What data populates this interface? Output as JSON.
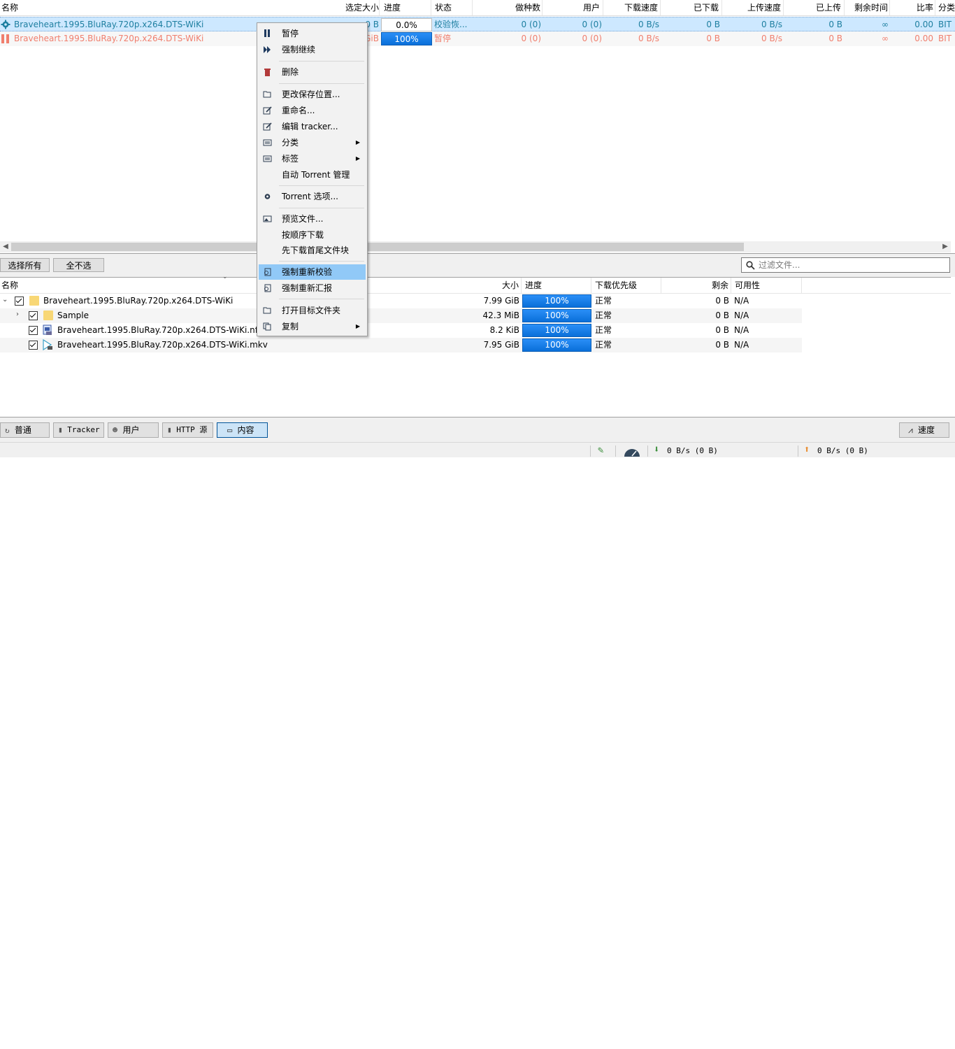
{
  "torrent_table": {
    "columns": [
      "名称",
      "选定大小",
      "进度",
      "状态",
      "做种数",
      "用户",
      "下载速度",
      "已下载",
      "上传速度",
      "已上传",
      "剩余时间",
      "比率",
      "分类"
    ],
    "rows": [
      {
        "name": "Braveheart.1995.BluRay.720p.x264.DTS-WiKi",
        "size": "0 B",
        "progress": "0.0%",
        "progress_value": 0,
        "status": "校验恢...",
        "seeds": "0 (0)",
        "peers": "0 (0)",
        "down_speed": "0 B/s",
        "downloaded": "0 B",
        "up_speed": "0 B/s",
        "uploaded": "0 B",
        "eta": "∞",
        "ratio": "0.00",
        "category": "BIT",
        "color": "#1e7fa0",
        "icon": "gear-icon"
      },
      {
        "name": "Braveheart.1995.BluRay.720p.x264.DTS-WiKi",
        "size": "GiB",
        "progress": "100%",
        "progress_value": 1,
        "status": "暂停",
        "seeds": "0 (0)",
        "peers": "0 (0)",
        "down_speed": "0 B/s",
        "downloaded": "0 B",
        "up_speed": "0 B/s",
        "uploaded": "0 B",
        "eta": "∞",
        "ratio": "0.00",
        "category": "BIT",
        "color": "#f07f6e",
        "icon": "pause-icon"
      }
    ]
  },
  "context_menu": {
    "items": [
      {
        "label": "暂停",
        "icon": "pause-icon"
      },
      {
        "label": "强制继续",
        "icon": "fast-forward-icon"
      },
      {
        "label": "删除",
        "icon": "trash-icon"
      },
      {
        "label": "更改保存位置...",
        "icon": "folder-open-icon"
      },
      {
        "label": "重命名...",
        "icon": "edit-icon"
      },
      {
        "label": "编辑 tracker...",
        "icon": "edit-icon"
      },
      {
        "label": "分类",
        "icon": "list-icon"
      },
      {
        "label": "标签",
        "icon": "list-icon"
      },
      {
        "label": "自动 Torrent 管理",
        "icon": ""
      },
      {
        "label": "Torrent 选项...",
        "icon": "gear-icon"
      },
      {
        "label": "预览文件...",
        "icon": "image-icon"
      },
      {
        "label": "按顺序下载",
        "icon": ""
      },
      {
        "label": "先下载首尾文件块",
        "icon": ""
      },
      {
        "label": "强制重新校验",
        "icon": "recheck-icon"
      },
      {
        "label": "强制重新汇报",
        "icon": "recheck-icon"
      },
      {
        "label": "打开目标文件夹",
        "icon": "folder-open-icon"
      },
      {
        "label": "复制",
        "icon": "copy-icon"
      }
    ],
    "highlighted": "强制重新校验"
  },
  "content_toolbar": {
    "select_all": "选择所有",
    "select_none": "全不选",
    "filter_placeholder": "过滤文件..."
  },
  "file_tree": {
    "columns": [
      "名称",
      "大小",
      "进度",
      "下载优先级",
      "剩余",
      "可用性"
    ],
    "rows": [
      {
        "name": "Braveheart.1995.BluRay.720p.x264.DTS-WiKi",
        "size": "7.99 GiB",
        "progress": "100%",
        "priority": "正常",
        "remaining": "0 B",
        "availability": "N/A",
        "icon": "folder-icon"
      },
      {
        "name": "Sample",
        "size": "42.3 MiB",
        "progress": "100%",
        "priority": "正常",
        "remaining": "0 B",
        "availability": "N/A",
        "icon": "folder-icon"
      },
      {
        "name": "Braveheart.1995.BluRay.720p.x264.DTS-WiKi.nfo",
        "size": "8.2 KiB",
        "progress": "100%",
        "priority": "正常",
        "remaining": "0 B",
        "availability": "N/A",
        "icon": "nfo-file-icon"
      },
      {
        "name": "Braveheart.1995.BluRay.720p.x264.DTS-WiKi.mkv",
        "size": "7.95 GiB",
        "progress": "100%",
        "priority": "正常",
        "remaining": "0 B",
        "availability": "N/A",
        "icon": "video-file-icon"
      }
    ]
  },
  "bottom_tabs": {
    "general": "普通",
    "tracker": "Tracker",
    "peers": "用户",
    "http": "HTTP 源",
    "content": "内容",
    "speed": "速度",
    "active": "内容"
  },
  "status_bar": {
    "download": "0 B/s (0 B)",
    "upload": "0 B/s (0 B)"
  },
  "colors": {
    "selection": "#cde8ff",
    "progress_blue": "#0a84ff",
    "menu_highlight": "#91c9f7",
    "checking": "#1e7fa0",
    "paused": "#f07f6e"
  }
}
